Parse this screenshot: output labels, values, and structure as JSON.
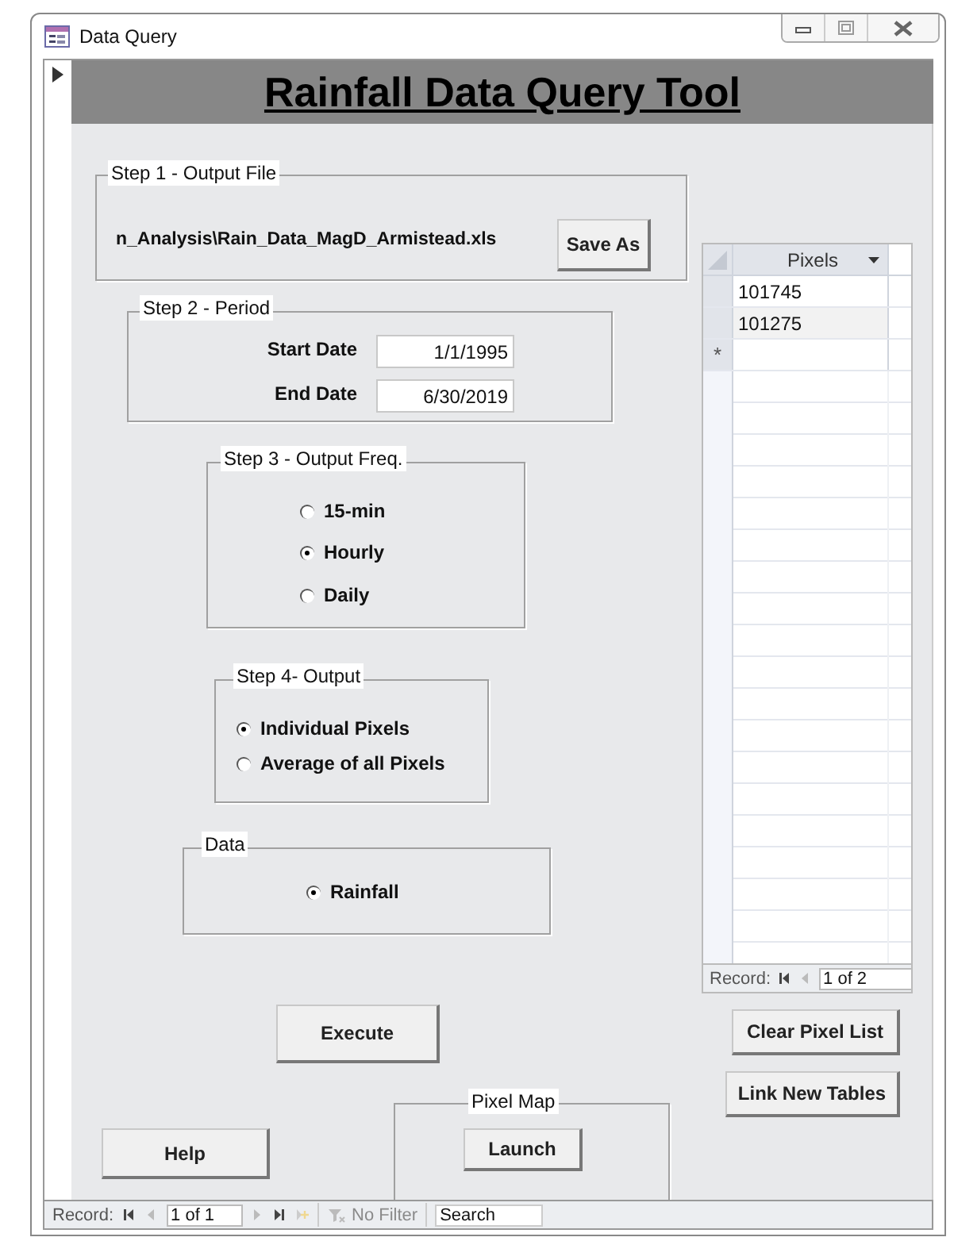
{
  "window": {
    "title": "Data Query"
  },
  "header": {
    "title": "Rainfall Data Query Tool"
  },
  "step1": {
    "label": "Step 1 - Output File",
    "path": "n_Analysis\\Rain_Data_MagD_Armistead.xls",
    "button": "Save As"
  },
  "step2": {
    "label": "Step 2 - Period",
    "fields": [
      {
        "label": "Start Date",
        "value": "1/1/1995"
      },
      {
        "label": "End Date",
        "value": "6/30/2019"
      }
    ]
  },
  "step3": {
    "label": "Step 3 -  Output Freq.",
    "options": [
      {
        "label": "15-min",
        "selected": false
      },
      {
        "label": "Hourly",
        "selected": true
      },
      {
        "label": "Daily",
        "selected": false
      }
    ]
  },
  "step4": {
    "label": "Step 4- Output",
    "options": [
      {
        "label": "Individual Pixels",
        "selected": true
      },
      {
        "label": "Average of all Pixels",
        "selected": false
      }
    ]
  },
  "data": {
    "label": "Data",
    "options": [
      {
        "label": "Rainfall",
        "selected": true
      }
    ]
  },
  "execute_button": "Execute",
  "help_button": "Help",
  "pixel_map": {
    "label": "Pixel Map",
    "button": "Launch"
  },
  "pixels_table": {
    "column": "Pixels",
    "rows": [
      "101745",
      "101275"
    ],
    "new_row_mark": "*",
    "record_label": "Record:",
    "position": "1 of 2"
  },
  "clear_button": "Clear Pixel List",
  "link_button": "Link New Tables",
  "status_bar": {
    "record_label": "Record:",
    "position": "1 of 1",
    "filter": {
      "label": "No Filter",
      "disabled": true
    },
    "search": {
      "placeholder": "Search"
    }
  }
}
